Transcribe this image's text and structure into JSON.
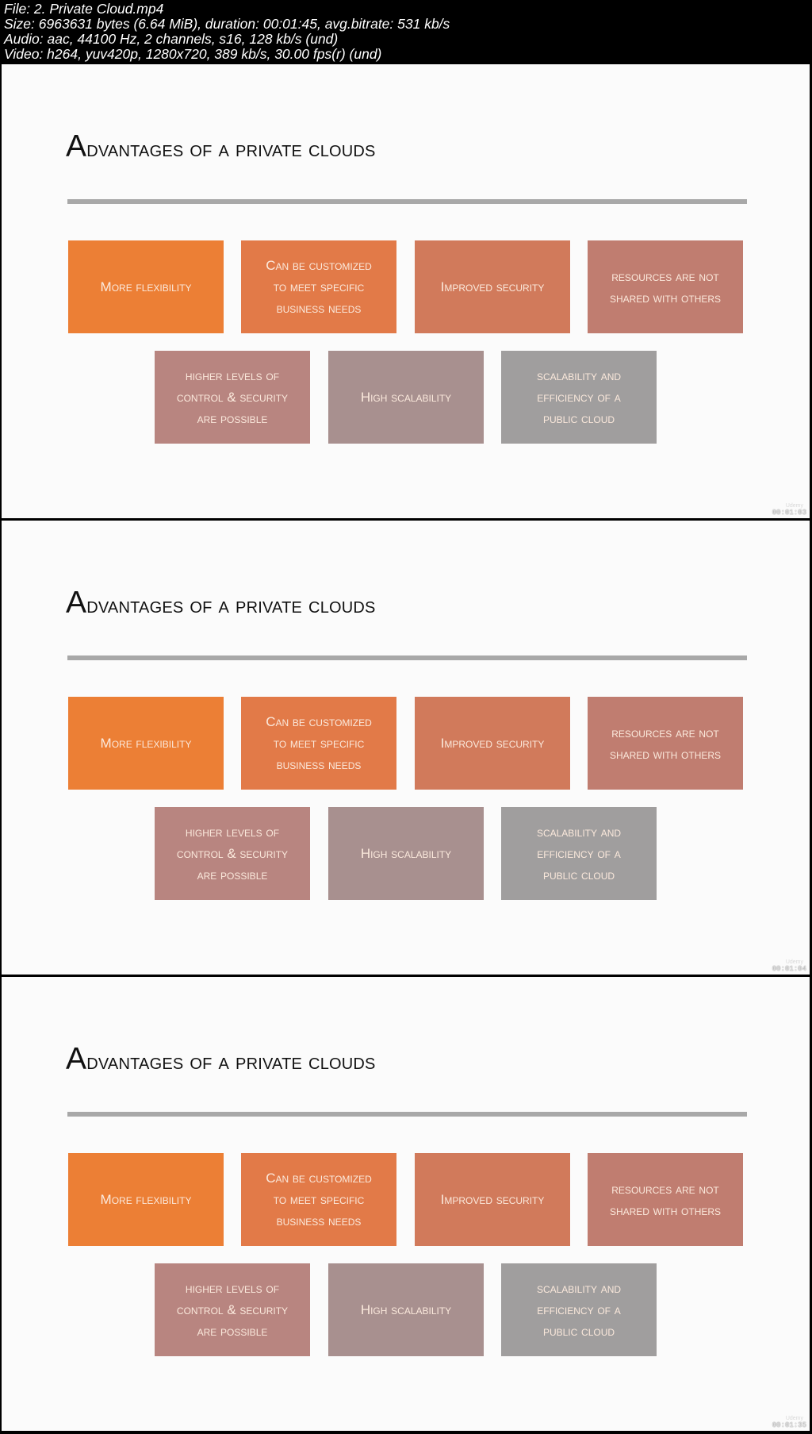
{
  "file_info": {
    "lines": [
      "File: 2. Private Cloud.mp4",
      "Size: 6963631 bytes (6.64 MiB), duration: 00:01:45, avg.bitrate: 531 kb/s",
      "Audio: aac, 44100 Hz, 2 channels, s16, 128 kb/s (und)",
      "Video: h264, yuv420p, 1280x720, 389 kb/s, 30.00 fps(r) (und)"
    ]
  },
  "slide": {
    "title_first": "A",
    "title_rest": "dvantages of a private clouds",
    "boxes": [
      {
        "lines": [
          "More flexibility"
        ],
        "color": "#ec7f35"
      },
      {
        "lines": [
          "Can be customized",
          "to meet specific",
          "business needs"
        ],
        "color": "#e27a48"
      },
      {
        "lines": [
          "Improved security"
        ],
        "color": "#d17a5b"
      },
      {
        "lines": [
          "resources are not",
          "shared with others"
        ],
        "color": "#c07d70"
      },
      {
        "lines": [
          "higher levels of",
          "control & security",
          "are possible"
        ],
        "color": "#b88580"
      },
      {
        "lines": [
          "High scalability"
        ],
        "color": "#a8908f"
      },
      {
        "lines": [
          "scalability and",
          "efficiency of a",
          "public cloud"
        ],
        "color": "#a09e9e"
      }
    ]
  },
  "frames": [
    {
      "timestamp": "00:01:03",
      "watermark": "Udemy"
    },
    {
      "timestamp": "00:01:04",
      "watermark": "Udemy"
    },
    {
      "timestamp": "00:01:35",
      "watermark": "Udemy"
    }
  ]
}
